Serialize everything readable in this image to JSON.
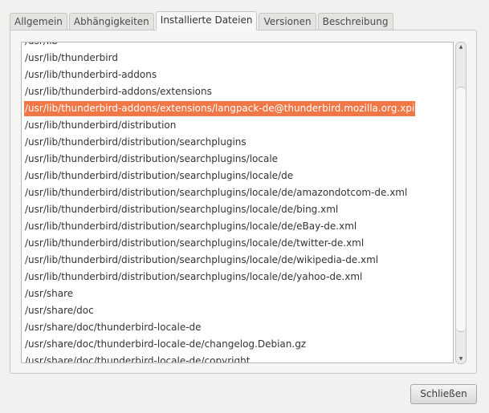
{
  "tabs": [
    "Allgemein",
    "Abhängigkeiten",
    "Installierte Dateien",
    "Versionen",
    "Beschreibung"
  ],
  "active_tab": 2,
  "files": [
    "/usr/lib",
    "/usr/lib/thunderbird",
    "/usr/lib/thunderbird-addons",
    "/usr/lib/thunderbird-addons/extensions",
    "/usr/lib/thunderbird-addons/extensions/langpack-de@thunderbird.mozilla.org.xpi",
    "/usr/lib/thunderbird/distribution",
    "/usr/lib/thunderbird/distribution/searchplugins",
    "/usr/lib/thunderbird/distribution/searchplugins/locale",
    "/usr/lib/thunderbird/distribution/searchplugins/locale/de",
    "/usr/lib/thunderbird/distribution/searchplugins/locale/de/amazondotcom-de.xml",
    "/usr/lib/thunderbird/distribution/searchplugins/locale/de/bing.xml",
    "/usr/lib/thunderbird/distribution/searchplugins/locale/de/eBay-de.xml",
    "/usr/lib/thunderbird/distribution/searchplugins/locale/de/twitter-de.xml",
    "/usr/lib/thunderbird/distribution/searchplugins/locale/de/wikipedia-de.xml",
    "/usr/lib/thunderbird/distribution/searchplugins/locale/de/yahoo-de.xml",
    "/usr/share",
    "/usr/share/doc",
    "/usr/share/doc/thunderbird-locale-de",
    "/usr/share/doc/thunderbird-locale-de/changelog.Debian.gz",
    "/usr/share/doc/thunderbird-locale-de/copyright"
  ],
  "selected_index": 4,
  "close_button": "Schließen",
  "colors": {
    "selection": "#f07746"
  }
}
